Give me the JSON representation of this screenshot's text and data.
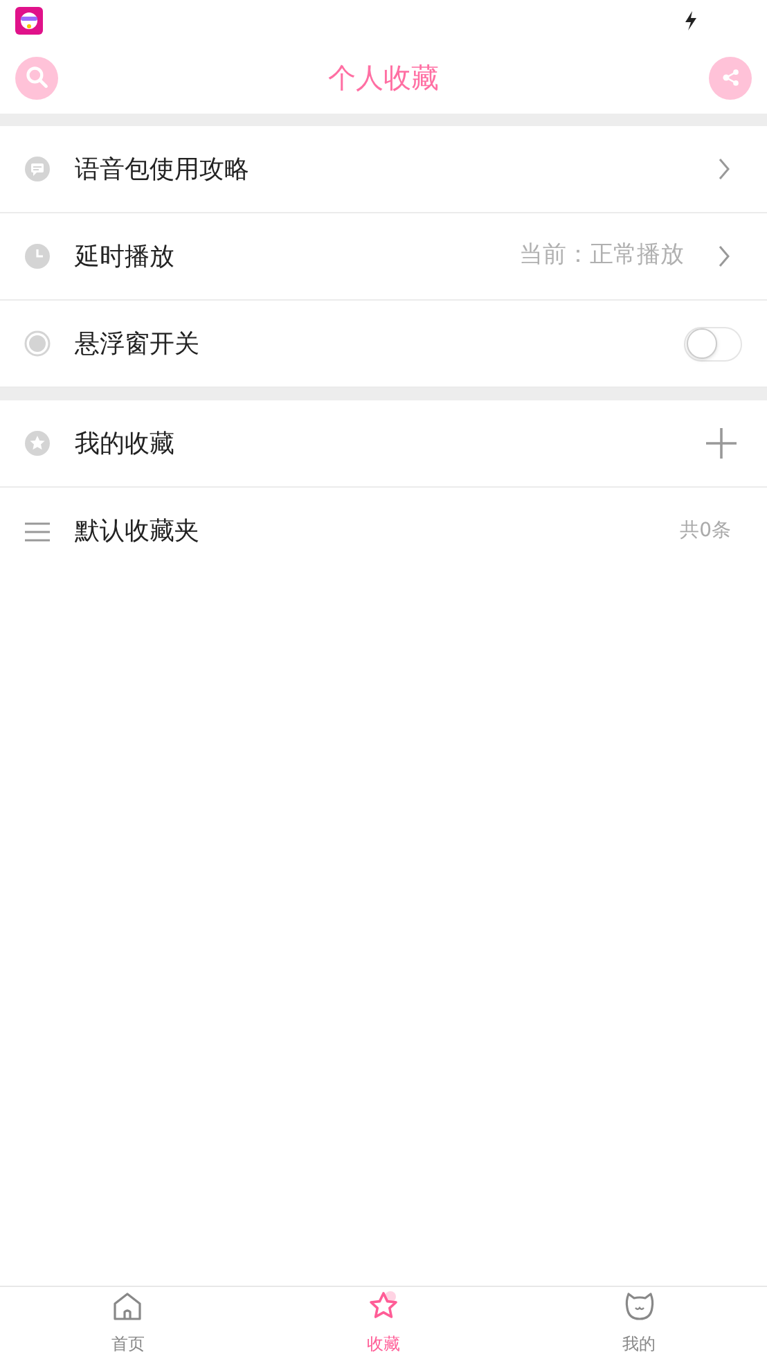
{
  "header": {
    "title": "个人收藏"
  },
  "sections": [
    {
      "rows": [
        {
          "kind": "link",
          "label": "语音包使用攻略"
        },
        {
          "kind": "link",
          "label": "延时播放",
          "value": "当前：正常播放"
        },
        {
          "kind": "toggle",
          "label": "悬浮窗开关",
          "on": false
        }
      ]
    },
    {
      "rows": [
        {
          "kind": "add",
          "label": "我的收藏"
        },
        {
          "kind": "count",
          "label": "默认收藏夹",
          "count": "共0条"
        }
      ]
    }
  ],
  "tabs": [
    {
      "label": "首页",
      "selected": false
    },
    {
      "label": "收藏",
      "selected": true
    },
    {
      "label": "我的",
      "selected": false
    }
  ]
}
